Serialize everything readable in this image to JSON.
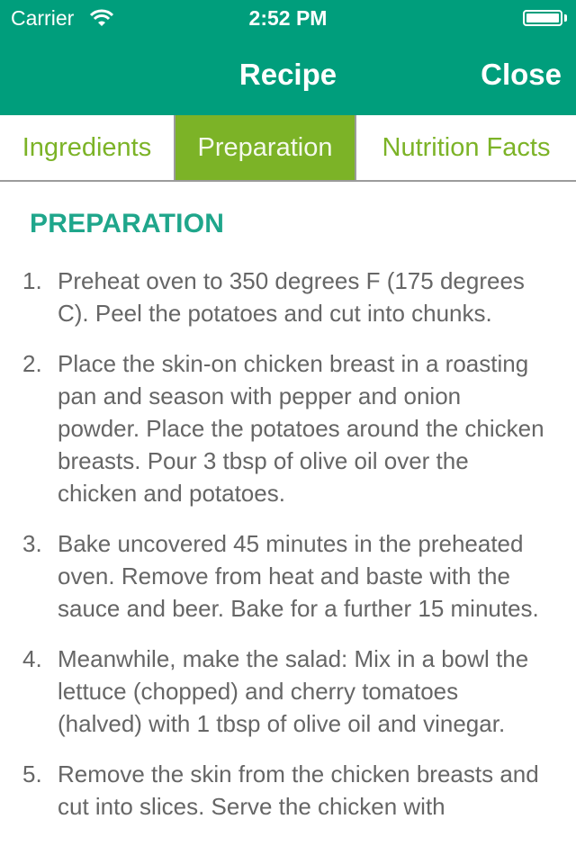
{
  "status_bar": {
    "carrier": "Carrier",
    "time": "2:52 PM",
    "wifi_icon": "wifi-icon",
    "battery_icon": "battery-full-icon"
  },
  "nav": {
    "title": "Recipe",
    "close_label": "Close"
  },
  "tabs": [
    {
      "label": "Ingredients",
      "active": false
    },
    {
      "label": "Preparation",
      "active": true
    },
    {
      "label": "Nutrition Facts",
      "active": false
    }
  ],
  "colors": {
    "header_bg": "#009e7c",
    "tab_accent": "#7cb327",
    "section_title": "#1fa68b",
    "body_text": "#666666"
  },
  "content": {
    "section_title": "PREPARATION",
    "steps": [
      {
        "number": "1.",
        "text": "Preheat oven to 350 degrees F (175 degrees C). Peel the potatoes and cut into chunks."
      },
      {
        "number": "2.",
        "text": "Place the skin-on chicken breast in a roasting pan and season with pepper and onion powder. Place the potatoes around the chicken breasts. Pour 3 tbsp of olive oil over the chicken and potatoes."
      },
      {
        "number": "3.",
        "text": "Bake uncovered 45 minutes in the preheated oven. Remove from heat and baste with the sauce and beer. Bake for a further 15 minutes."
      },
      {
        "number": "4.",
        "text": "Meanwhile, make the salad: Mix in a bowl the lettuce (chopped) and cherry tomatoes (halved) with 1 tbsp of olive oil and vinegar."
      },
      {
        "number": "5.",
        "text": "Remove the skin from the chicken breasts and cut into slices. Serve the chicken with"
      }
    ]
  }
}
